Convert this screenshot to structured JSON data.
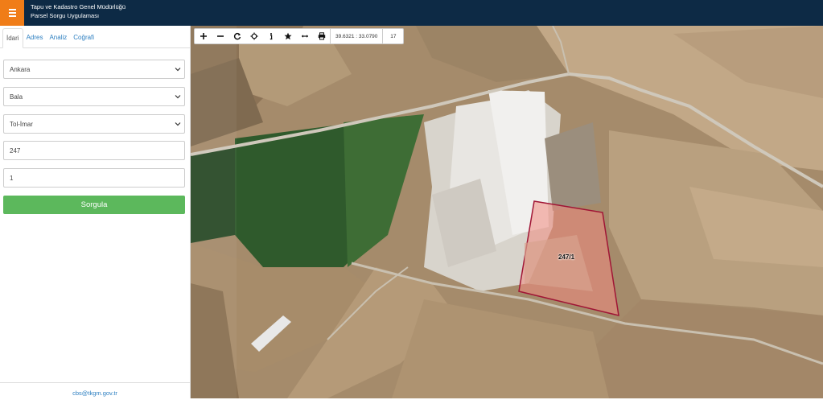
{
  "header": {
    "org_name": "Tapu ve Kadastro Genel Müdürlüğü",
    "app_name": "Parsel Sorgu Uygulaması",
    "menu_icon": "hamburger-icon",
    "colors": {
      "header_bg": "#0d2a45",
      "menu_bg": "#f07d18"
    }
  },
  "sidebar": {
    "tabs": [
      {
        "label": "İdari",
        "active": true
      },
      {
        "label": "Adres",
        "active": false
      },
      {
        "label": "Analiz",
        "active": false
      },
      {
        "label": "Coğrafi",
        "active": false
      }
    ],
    "form": {
      "province": "Ankara",
      "district": "Bala",
      "neighborhood": "Tol-İmar",
      "block": "247",
      "parcel": "1",
      "submit_label": "Sorgula"
    },
    "footer_email": "cbs@tkgm.gov.tr",
    "colors": {
      "submit": "#5cb85c",
      "link": "#2d7fc1"
    }
  },
  "map": {
    "toolbar": {
      "buttons": [
        "zoom-in-icon",
        "zoom-out-icon",
        "refresh-icon",
        "locate-icon",
        "info-icon",
        "star-icon",
        "measure-icon",
        "print-icon"
      ],
      "coordinate": "39.6321 : 33.0790",
      "zoom_level": "17"
    },
    "parcel_label": "247/1",
    "colors": {
      "parcel_stroke": "#a01535",
      "parcel_fill": "#f08a80"
    }
  }
}
